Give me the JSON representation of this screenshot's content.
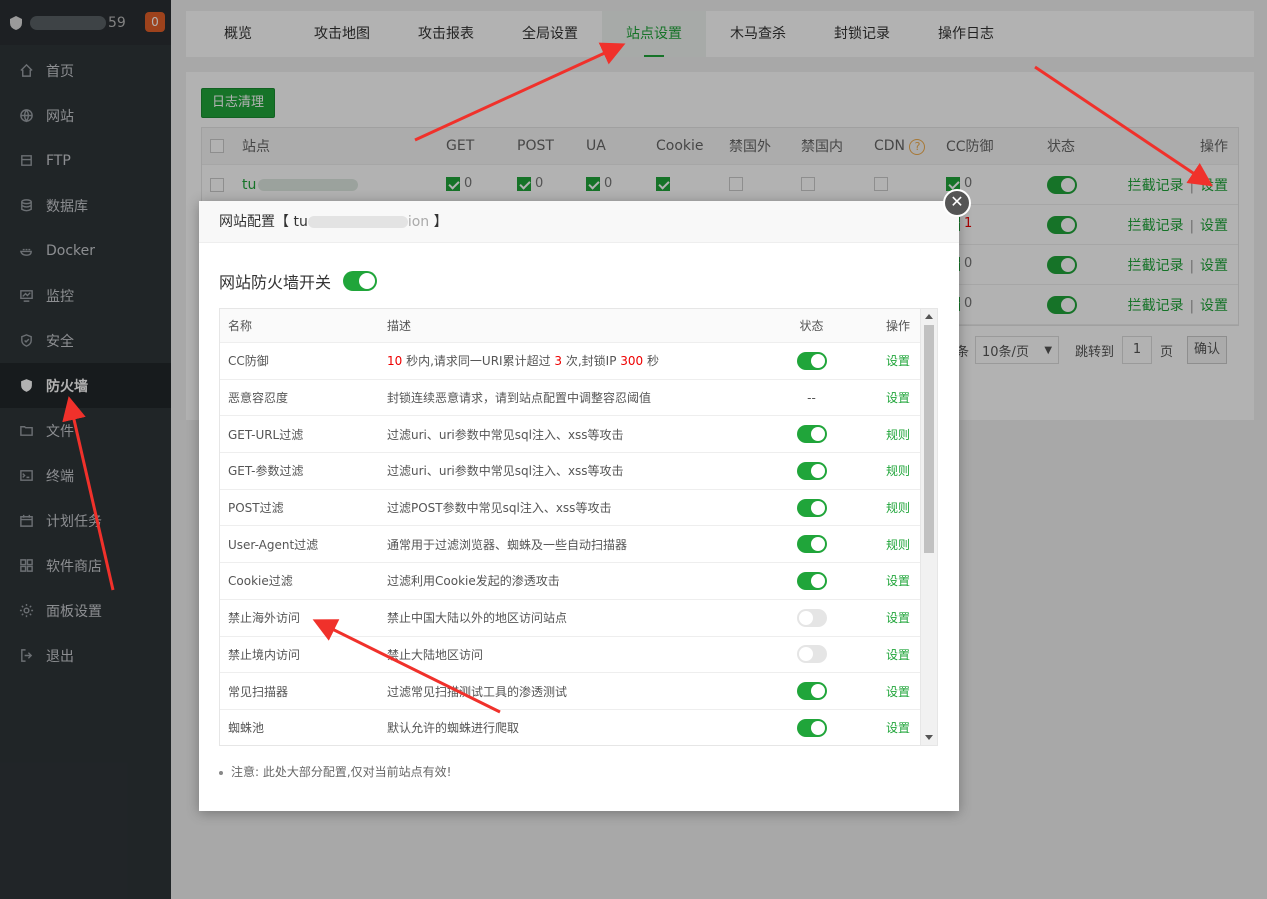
{
  "sidebar": {
    "username_suffix": "59",
    "badge": "0",
    "items": [
      {
        "label": "首页",
        "icon": "home-icon"
      },
      {
        "label": "网站",
        "icon": "globe-icon"
      },
      {
        "label": "FTP",
        "icon": "ftp-icon"
      },
      {
        "label": "数据库",
        "icon": "database-icon"
      },
      {
        "label": "Docker",
        "icon": "docker-icon"
      },
      {
        "label": "监控",
        "icon": "monitor-icon"
      },
      {
        "label": "安全",
        "icon": "shield-check-icon"
      },
      {
        "label": "防火墙",
        "icon": "firewall-shield-icon"
      },
      {
        "label": "文件",
        "icon": "folder-icon"
      },
      {
        "label": "终端",
        "icon": "terminal-icon"
      },
      {
        "label": "计划任务",
        "icon": "calendar-icon"
      },
      {
        "label": "软件商店",
        "icon": "apps-grid-icon"
      },
      {
        "label": "面板设置",
        "icon": "gear-icon"
      },
      {
        "label": "退出",
        "icon": "logout-icon"
      }
    ]
  },
  "tabs": [
    "概览",
    "攻击地图",
    "攻击报表",
    "全局设置",
    "站点设置",
    "木马查杀",
    "封锁记录",
    "操作日志"
  ],
  "content": {
    "clear_log_button": "日志清理",
    "columns": [
      "站点",
      "GET",
      "POST",
      "UA",
      "Cookie",
      "禁国外",
      "禁国内",
      "CDN",
      "CC防御",
      "状态",
      "操作"
    ],
    "site_prefix": "tu",
    "rows": [
      {
        "get": "0",
        "post": "0",
        "ua": "0",
        "cc": "0"
      },
      {
        "cc": "1"
      },
      {
        "cc": "0"
      },
      {
        "cc": "0"
      }
    ],
    "action_log": "拦截记录",
    "action_sep": "|",
    "action_set": "设置",
    "pager": {
      "per_page": "10条/页",
      "goto_label": "跳转到",
      "page_value": "1",
      "page_unit": "页",
      "confirm": "确认",
      "partial": "条"
    }
  },
  "modal": {
    "title_prefix": "网站配置【 tu",
    "title_mid": "ion",
    "title_suffix": "】",
    "switch_label": "网站防火墙开关",
    "headers": [
      "名称",
      "描述",
      "状态",
      "操作"
    ],
    "cc_row": {
      "name": "CC防御",
      "seconds": "10",
      "t1": " 秒内,请求同一URI累计超过 ",
      "count": "3",
      "t2": " 次,封锁IP ",
      "block": "300",
      "t3": " 秒",
      "action": "设置"
    },
    "rows": [
      {
        "name": "恶意容忍度",
        "desc": "封锁连续恶意请求，请到站点配置中调整容忍阈值",
        "status": "--",
        "action": "设置"
      },
      {
        "name": "GET-URL过滤",
        "desc": "过滤uri、uri参数中常见sql注入、xss等攻击",
        "status": "on",
        "action": "规则"
      },
      {
        "name": "GET-参数过滤",
        "desc": "过滤uri、uri参数中常见sql注入、xss等攻击",
        "status": "on",
        "action": "规则"
      },
      {
        "name": "POST过滤",
        "desc": "过滤POST参数中常见sql注入、xss等攻击",
        "status": "on",
        "action": "规则"
      },
      {
        "name": "User-Agent过滤",
        "desc": "通常用于过滤浏览器、蜘蛛及一些自动扫描器",
        "status": "on",
        "action": "规则"
      },
      {
        "name": "Cookie过滤",
        "desc": "过滤利用Cookie发起的渗透攻击",
        "status": "on",
        "action": "设置"
      },
      {
        "name": "禁止海外访问",
        "desc": "禁止中国大陆以外的地区访问站点",
        "status": "off",
        "action": "设置"
      },
      {
        "name": "禁止境内访问",
        "desc": "禁止大陆地区访问",
        "status": "off",
        "action": "设置"
      },
      {
        "name": "常见扫描器",
        "desc": "过滤常见扫描测试工具的渗透测试",
        "status": "on",
        "action": "设置"
      },
      {
        "name": "蜘蛛池",
        "desc": "默认允许的蜘蛛进行爬取",
        "status": "on",
        "action": "设置"
      }
    ],
    "note": "注意: 此处大部分配置,仅对当前站点有效!",
    "close_symbol": "✕"
  },
  "colors": {
    "accent": "#20a53a",
    "sidebar": "#2f3539",
    "badge": "#e15f29",
    "arrow": "#f0312b"
  }
}
